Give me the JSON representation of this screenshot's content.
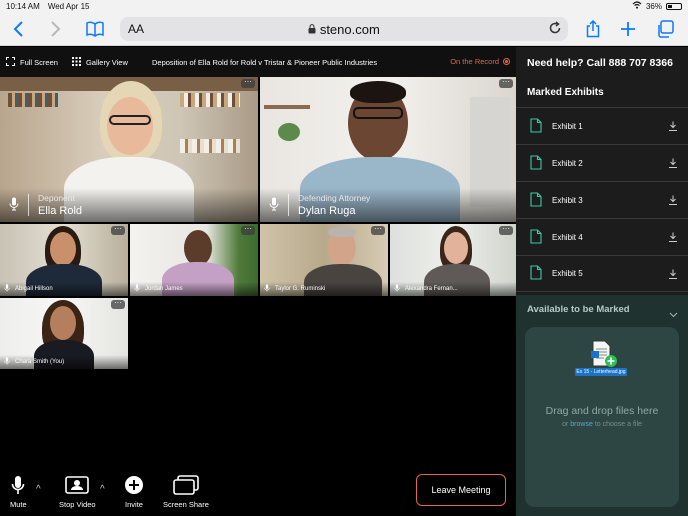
{
  "status_bar": {
    "time": "10:14 AM",
    "date": "Wed Apr 15",
    "battery": "36%",
    "battery_fraction": 0.36
  },
  "browser": {
    "text_size_label": "AA",
    "url": "steno.com",
    "icons": [
      "back-icon",
      "forward-icon",
      "bookmarks-icon",
      "lock-icon",
      "reload-icon",
      "share-icon",
      "new-tab-icon",
      "tabs-icon"
    ]
  },
  "meeting_bar": {
    "fullscreen_label": "Full Screen",
    "gallery_label": "Gallery View",
    "title": "Deposition of Ella Rold for Rold v Tristar & Pioneer Public Industries",
    "record_label": "On the Record"
  },
  "participants": {
    "main": [
      {
        "role": "Deponent",
        "name": "Ella Rold"
      },
      {
        "role": "Defending Attorney",
        "name": "Dylan Ruga"
      }
    ],
    "small": [
      {
        "name": "Abigail Hillson"
      },
      {
        "name": "Jordan James"
      },
      {
        "name": "Taylor G. Ruminski"
      },
      {
        "name": "Alexandra Fernan..."
      },
      {
        "name": "Chara Smith (You)"
      }
    ],
    "more_label": "···"
  },
  "controls": {
    "mute": "Mute",
    "stop_video": "Stop Video",
    "invite": "Invite",
    "screen_share": "Screen Share",
    "leave": "Leave Meeting"
  },
  "panel": {
    "help": "Need help? Call 888 707 8366",
    "marked_title": "Marked Exhibits",
    "exhibits": [
      {
        "label": "Exhibit 1"
      },
      {
        "label": "Exhibit 2"
      },
      {
        "label": "Exhibit 3"
      },
      {
        "label": "Exhibit 4"
      },
      {
        "label": "Exhibit 5"
      }
    ],
    "available_title": "Available to be Marked",
    "drop_text": "Drag and drop files here",
    "or_text": "or",
    "browse_text": "browse",
    "choose_text": "to choose a file",
    "dragged_file": "Ex 15 - Letterhead.jpg"
  },
  "colors": {
    "accent": "#3dcaa4",
    "record": "#e0664d",
    "panel_bg": "#1c1c1c",
    "available_bg": "#1f3230",
    "link": "#5aa8c7"
  }
}
